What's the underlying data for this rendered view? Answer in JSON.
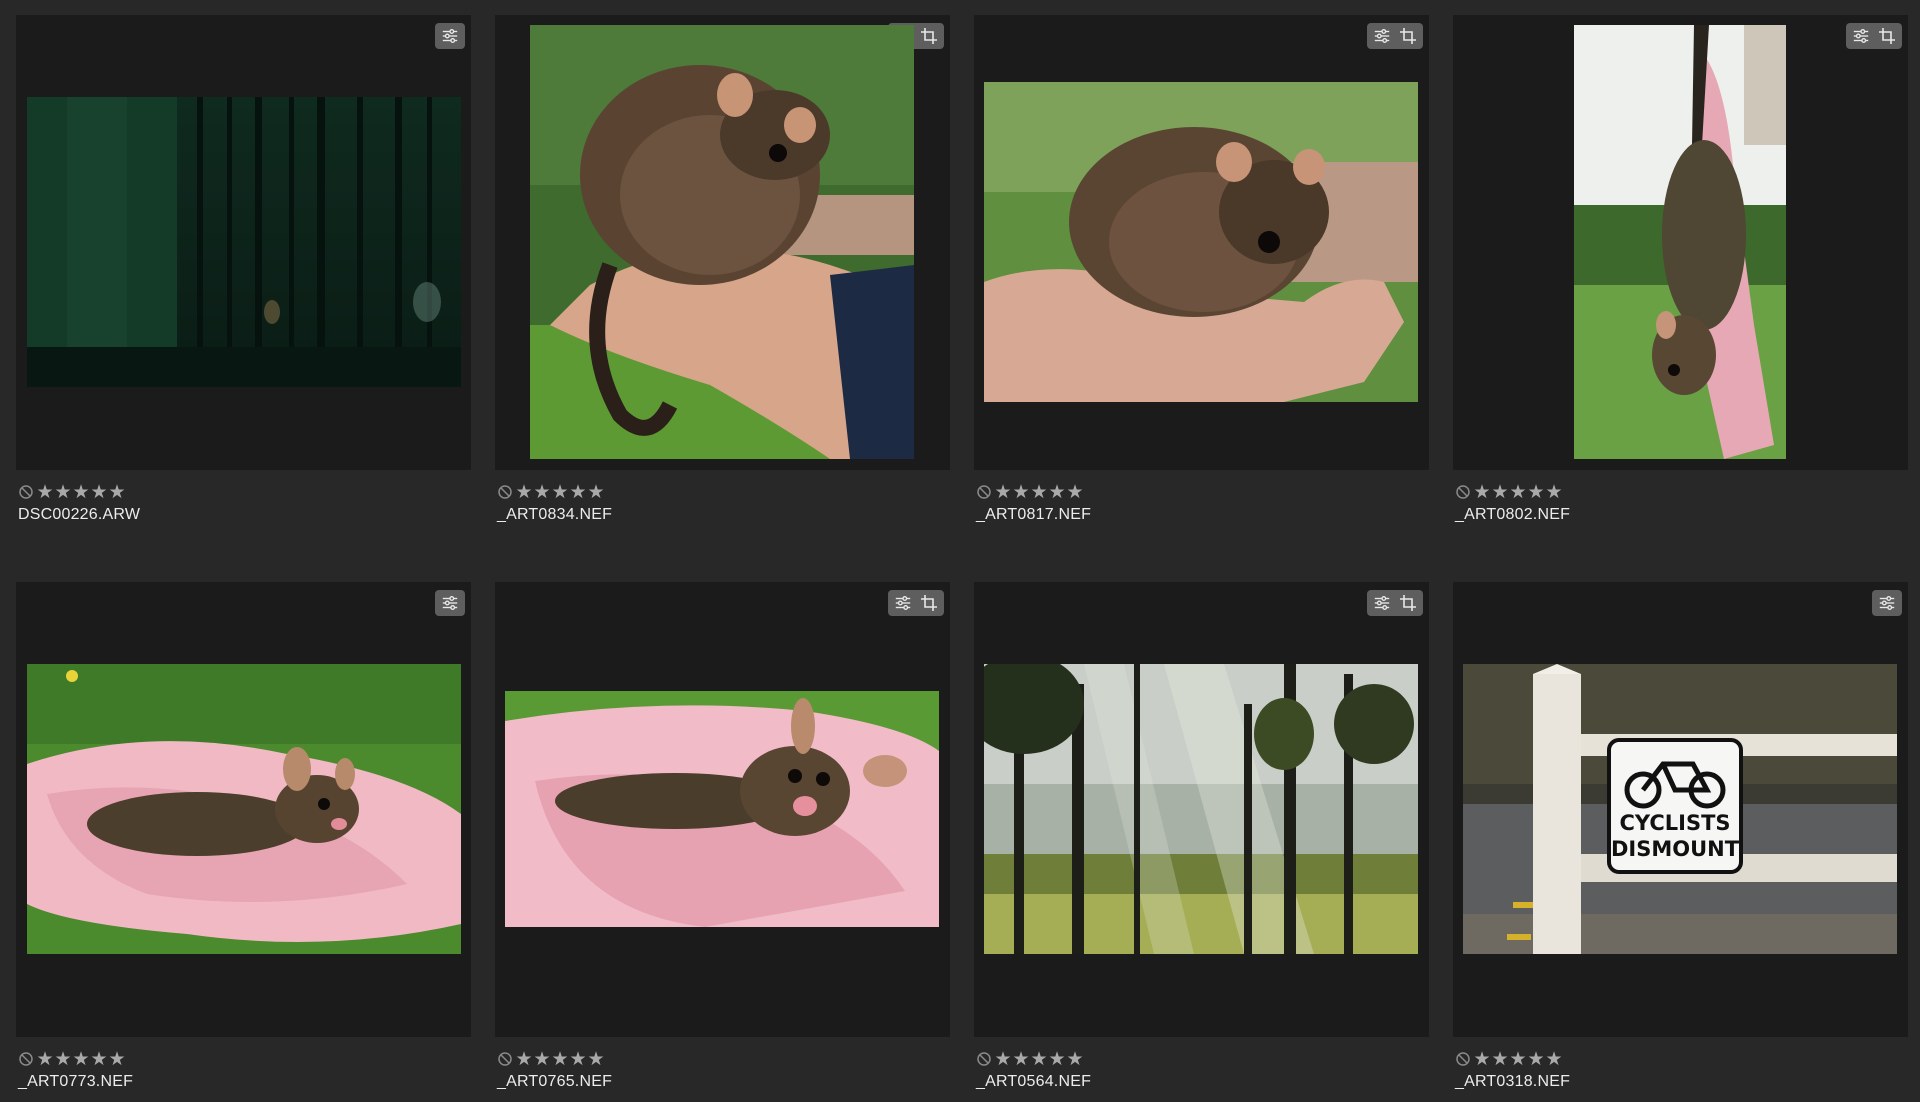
{
  "thumbnails": [
    {
      "filename": "DSC00226.ARW",
      "rating": 5,
      "badges": [
        "adjustments-icon"
      ],
      "scene": "dark-pine-forest"
    },
    {
      "filename": "_ART0834.NEF",
      "rating": 5,
      "badges": [
        "adjustments-icon",
        "crop-icon"
      ],
      "scene": "possum-on-hand-portrait"
    },
    {
      "filename": "_ART0817.NEF",
      "rating": 5,
      "badges": [
        "adjustments-icon",
        "crop-icon"
      ],
      "scene": "possum-on-hand-landscape"
    },
    {
      "filename": "_ART0802.NEF",
      "rating": 5,
      "badges": [
        "adjustments-icon",
        "crop-icon"
      ],
      "scene": "possum-hanging-from-towel"
    },
    {
      "filename": "_ART0773.NEF",
      "rating": 5,
      "badges": [
        "adjustments-icon"
      ],
      "scene": "possum-on-pink-blanket"
    },
    {
      "filename": "_ART0765.NEF",
      "rating": 5,
      "badges": [
        "adjustments-icon",
        "crop-icon"
      ],
      "scene": "possum-on-pink-blanket-closeup"
    },
    {
      "filename": "_ART0564.NEF",
      "rating": 5,
      "badges": [
        "adjustments-icon",
        "crop-icon"
      ],
      "scene": "misty-forest-sunrays"
    },
    {
      "filename": "_ART0318.NEF",
      "rating": 5,
      "badges": [
        "adjustments-icon"
      ],
      "scene": "cyclists-dismount-sign"
    }
  ],
  "sign": {
    "line1": "CYCLISTS",
    "line2": "DISMOUNT"
  },
  "colors": {
    "background": "#282828",
    "frame": "#1b1b1b",
    "badge": "#5e5e5e",
    "star": "#a9a9a9",
    "text": "#ececec"
  }
}
